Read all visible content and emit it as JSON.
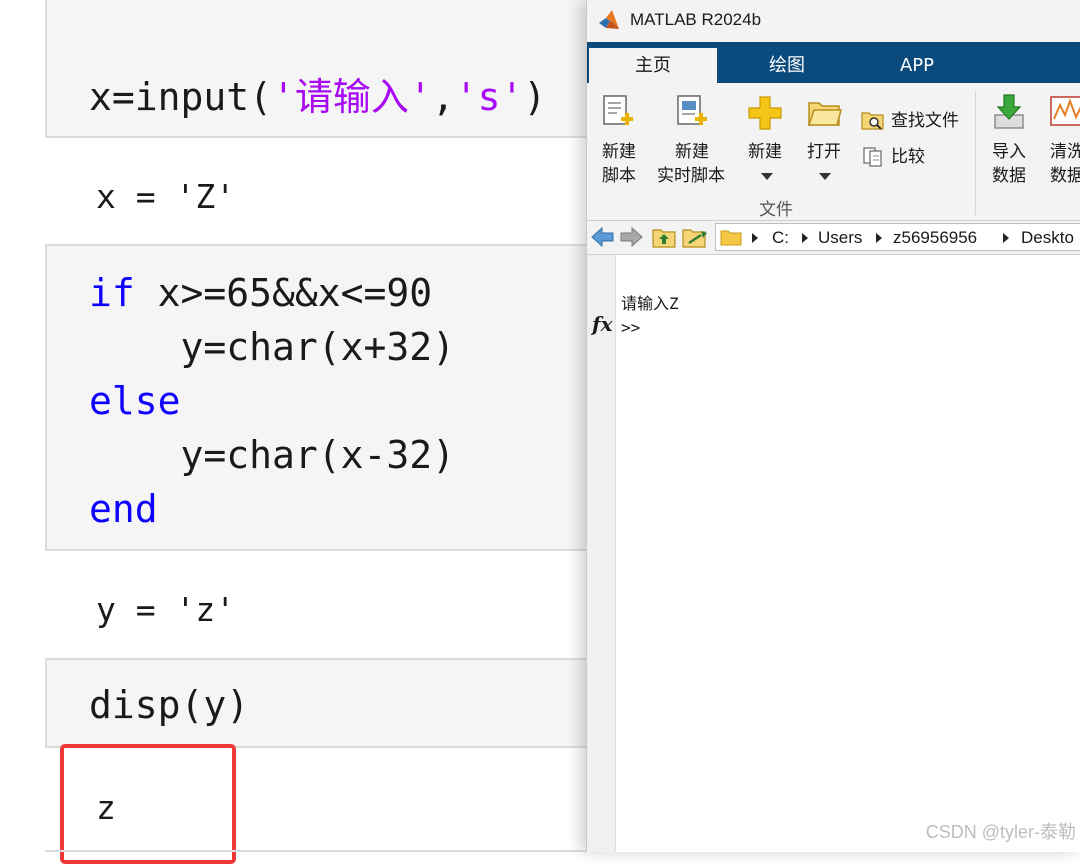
{
  "live_script": {
    "cell1": {
      "p1": "x=input(",
      "s1": "'请输入'",
      "p2": ",",
      "s2": "'s'",
      "p3": ")"
    },
    "output1": "x = 'Z'",
    "cell2": {
      "kw_if": "if",
      "cond": " x>=65&&x<=90",
      "line2": "    y=char(x+32)",
      "kw_else": "else",
      "line4": "    y=char(x-32)",
      "kw_end": "end"
    },
    "output2": "y = 'z'",
    "cell3": "disp(y)",
    "output3": "z"
  },
  "matlab": {
    "title": "MATLAB R2024b",
    "tabs": [
      "主页",
      "绘图",
      "APP"
    ],
    "toolstrip": {
      "new_script_l1": "新建",
      "new_script_l2": "脚本",
      "new_live_l1": "新建",
      "new_live_l2": "实时脚本",
      "new": "新建",
      "open": "打开",
      "find_files": "查找文件",
      "compare": "比较",
      "file_section": "文件",
      "import_l1": "导入",
      "import_l2": "数据",
      "clean_l1": "清洗",
      "clean_l2": "数据"
    },
    "path": [
      "C:",
      "Users",
      "z56956956",
      "Deskto"
    ],
    "command_window": {
      "output_line": "请输入Z",
      "prompt": ">>",
      "fx": "fx"
    }
  },
  "watermark": "CSDN @tyler-泰勒",
  "colors": {
    "keyword": "#0e00ff",
    "string": "#a709f5",
    "tabbar": "#0b4a7d",
    "highlight": "#f03838"
  }
}
